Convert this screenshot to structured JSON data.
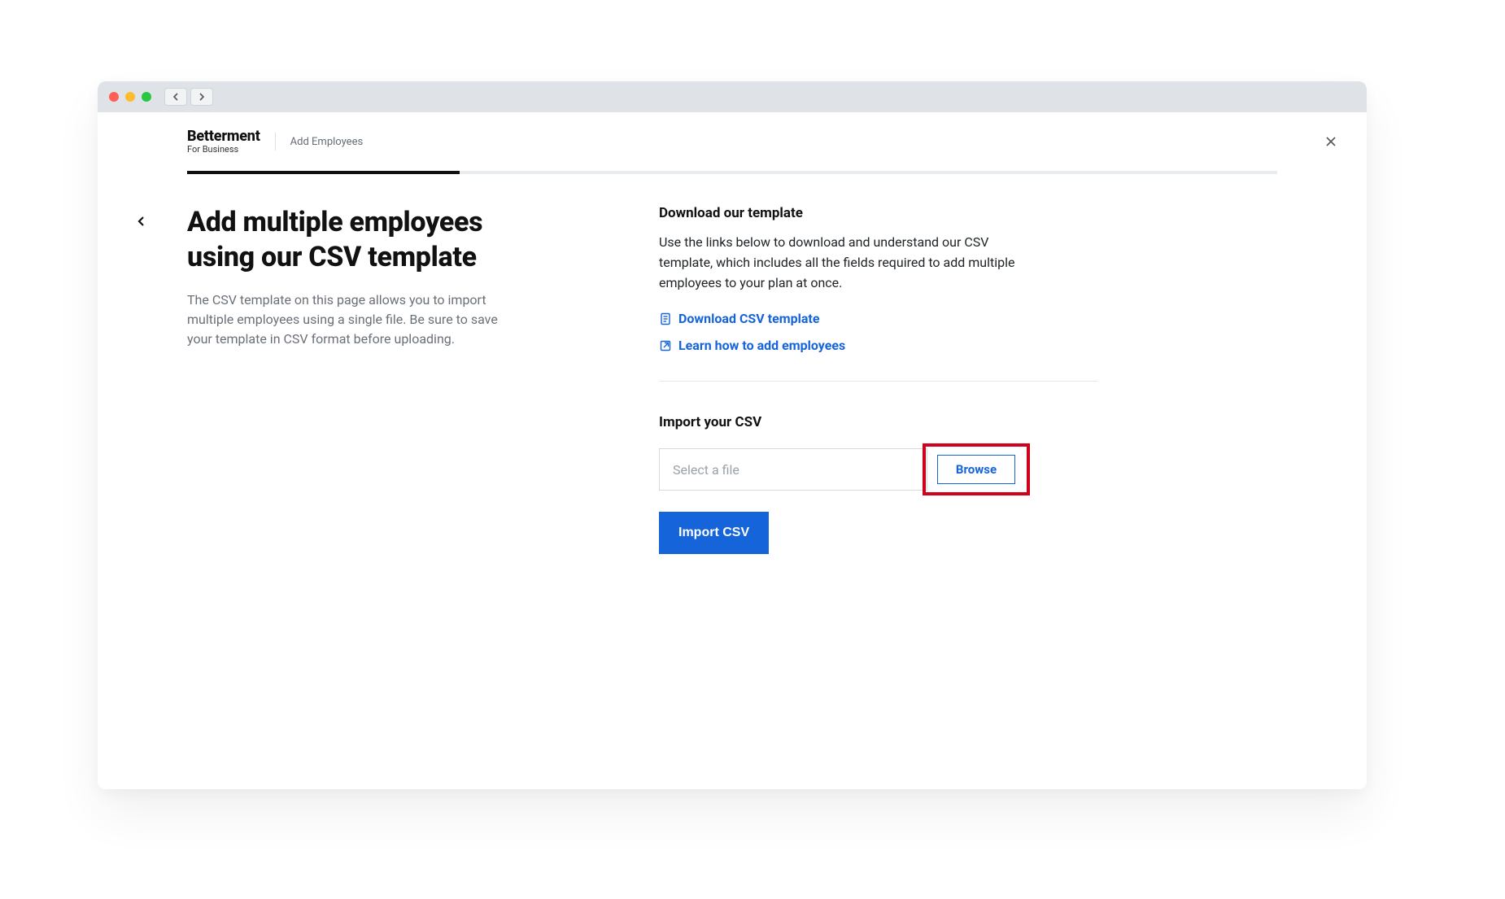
{
  "brand": {
    "name": "Betterment",
    "sub": "For Business"
  },
  "breadcrumb": "Add Employees",
  "progress_percent": 25,
  "left": {
    "title": "Add multiple employees using our CSV template",
    "subtitle": "The CSV template on this page allows you to import multiple employees using a single file. Be sure to save your template in CSV format before uploading."
  },
  "right": {
    "download": {
      "heading": "Download our template",
      "desc": "Use the links below to download and understand our CSV template, which includes all the fields required to add multiple employees to your plan at once.",
      "link_download": "Download CSV template",
      "link_learn": "Learn how to add employees"
    },
    "import": {
      "heading": "Import your CSV",
      "file_placeholder": "Select a file",
      "browse_label": "Browse",
      "submit_label": "Import CSV"
    }
  },
  "colors": {
    "accent": "#1664d9",
    "highlight": "#d0021b"
  }
}
